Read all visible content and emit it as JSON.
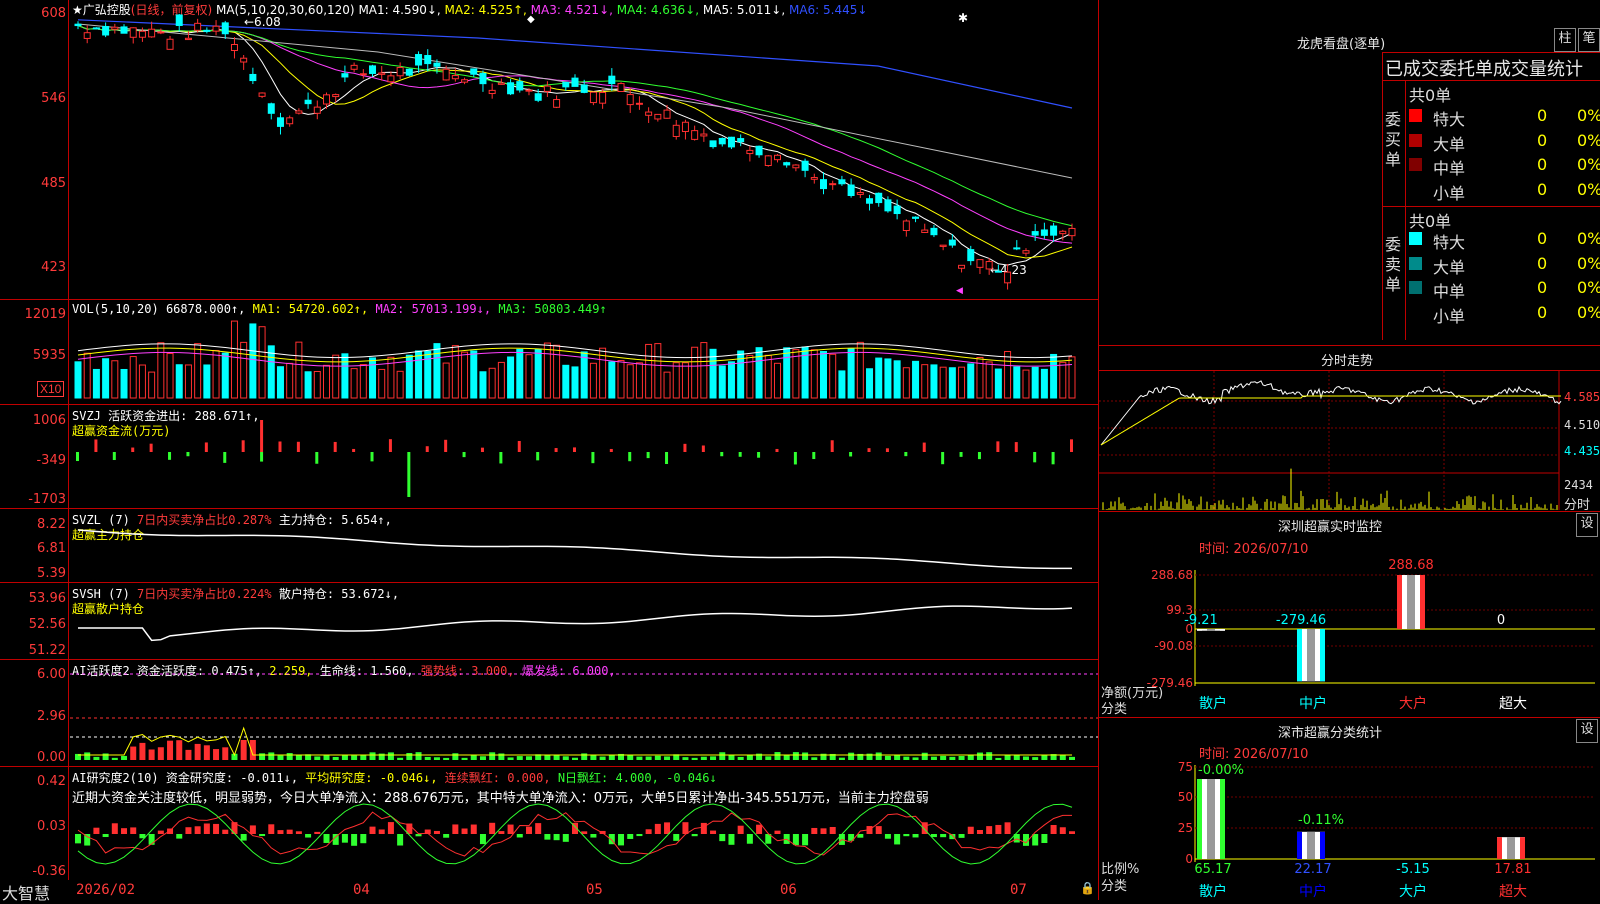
{
  "stock": {
    "star": "★",
    "name": "广弘控股",
    "mode": "(日线，前复权)",
    "ma_hdr": "MA(5,10,20,30,60,120)",
    "ma1": "MA1: 4.590↓,",
    "ma2": "MA2: 4.525↑,",
    "ma3": "MA3: 4.521↓,",
    "ma4": "MA4: 4.636↓,",
    "ma5": "MA5: 5.011↓,",
    "ma6": "MA6: 5.445↓",
    "high_label": "6.08",
    "low_label": "4.23",
    "y_axis": [
      "608",
      "546",
      "485",
      "423"
    ]
  },
  "vol": {
    "hdr": "VOL(5,10,20)",
    "value": "66878.000↑,",
    "ma1": "MA1: 54720.602↑,",
    "ma2": "MA2: 57013.199↓,",
    "ma3": "MA3: 50803.449↑",
    "y_axis": [
      "12019",
      "5935"
    ],
    "unit": "X10"
  },
  "svzj": {
    "hdr": "SVZJ",
    "line1": "活跃资金进出: 288.671↑,",
    "line2": "超赢资金流(万元)",
    "y_axis": [
      "1006",
      "-349",
      "-1703"
    ]
  },
  "svzl": {
    "hdr": "SVZL (7)",
    "ratio": "7日内买卖净占比0.287%",
    "holding": "主力持仓: 5.654↑,",
    "sub": "超赢主力持仓",
    "y_axis": [
      "8.22",
      "6.81",
      "5.39"
    ]
  },
  "svsh": {
    "hdr": "SVSH (7)",
    "ratio": "7日内买卖净占比0.224%",
    "holding": "散户持仓: 53.672↓,",
    "sub": "超赢散户持仓",
    "y_axis": [
      "53.96",
      "52.56",
      "51.22"
    ]
  },
  "ai1": {
    "hdr": "AI活跃度2",
    "v1": "资金活跃度: 0.475↑,",
    "v2": "2.259,",
    "v3": "生命线: 1.560,",
    "v4": "强势线: 3.000,",
    "v5": "爆发线: 6.000,",
    "y_axis": [
      "6.00",
      "2.96",
      "0.00"
    ]
  },
  "ai2": {
    "hdr": "AI研究度2(10)",
    "v1": "资金研究度: -0.011↓,",
    "v2": "平均研究度: -0.046↓,",
    "v3": "连续飘红: 0.000,",
    "v4": "N日飘红: 4.000,",
    "v5": "-0.046↓",
    "comment": "近期大资金关注度较低，明显弱势，今日大单净流入：288.676万元，其中特大单净流入：0万元，大单5日累计净出-345.551万元，当前主力控盘弱",
    "y_axis": [
      "0.42",
      "0.03",
      "-0.36"
    ]
  },
  "bottom": {
    "brand": "大智慧",
    "dates": [
      "2026/02",
      "04",
      "05",
      "06",
      "07"
    ]
  },
  "right": {
    "dragon_title": "龙虎看盘(逐单)",
    "btn_bar": "柱",
    "btn_pen": "笔",
    "stats_title": "已成交委托单成交量统计",
    "buy_side": "委买单",
    "sell_side": "委卖单",
    "buy_total": "共0单",
    "sell_total": "共0单",
    "buy_rows": [
      {
        "label": "特大",
        "count": "0",
        "pct": "0%",
        "color": "#ff0000"
      },
      {
        "label": "大单",
        "count": "0",
        "pct": "0%",
        "color": "#b00000"
      },
      {
        "label": "中单",
        "count": "0",
        "pct": "0%",
        "color": "#800000"
      },
      {
        "label": "小单",
        "count": "0",
        "pct": "0%",
        "color": ""
      }
    ],
    "sell_rows": [
      {
        "label": "特大",
        "count": "0",
        "pct": "0%",
        "color": "#00ffff"
      },
      {
        "label": "大单",
        "count": "0",
        "pct": "0%",
        "color": "#008b8b"
      },
      {
        "label": "中单",
        "count": "0",
        "pct": "0%",
        "color": "#007070"
      },
      {
        "label": "小单",
        "count": "0",
        "pct": "0%",
        "color": ""
      }
    ],
    "intraday_title": "分时走势",
    "intraday_y": [
      "4.585",
      "4.510",
      "4.435"
    ],
    "intraday_vol": "2434",
    "intraday_vol_label": "分时",
    "monitor_title": "深圳超赢实时监控",
    "monitor_btn": "设",
    "monitor_time": "时间: 2026/07/10",
    "monitor_y": [
      "288.68",
      "99.3",
      "0",
      "-90.08",
      "-279.46"
    ],
    "monitor_values": [
      "-9.21",
      "-279.46",
      "288.68",
      "0"
    ],
    "monitor_axis_label1": "净额(万元)",
    "monitor_axis_label2": "分类",
    "monitor_cats": [
      "散户",
      "中户",
      "大户",
      "超大"
    ],
    "classify_title": "深市超赢分类统计",
    "classify_btn": "设",
    "classify_time": "时间: 2026/07/10",
    "classify_y": [
      "75",
      "50",
      "25",
      "0"
    ],
    "classify_top": [
      "-0.00%",
      "-0.11%"
    ],
    "classify_values": [
      "65.17",
      "22.17",
      "-5.15",
      "17.81"
    ],
    "classify_axis_label1": "比例%",
    "classify_axis_label2": "分类",
    "classify_cats": [
      "散户",
      "中户",
      "大户",
      "超大"
    ]
  }
}
